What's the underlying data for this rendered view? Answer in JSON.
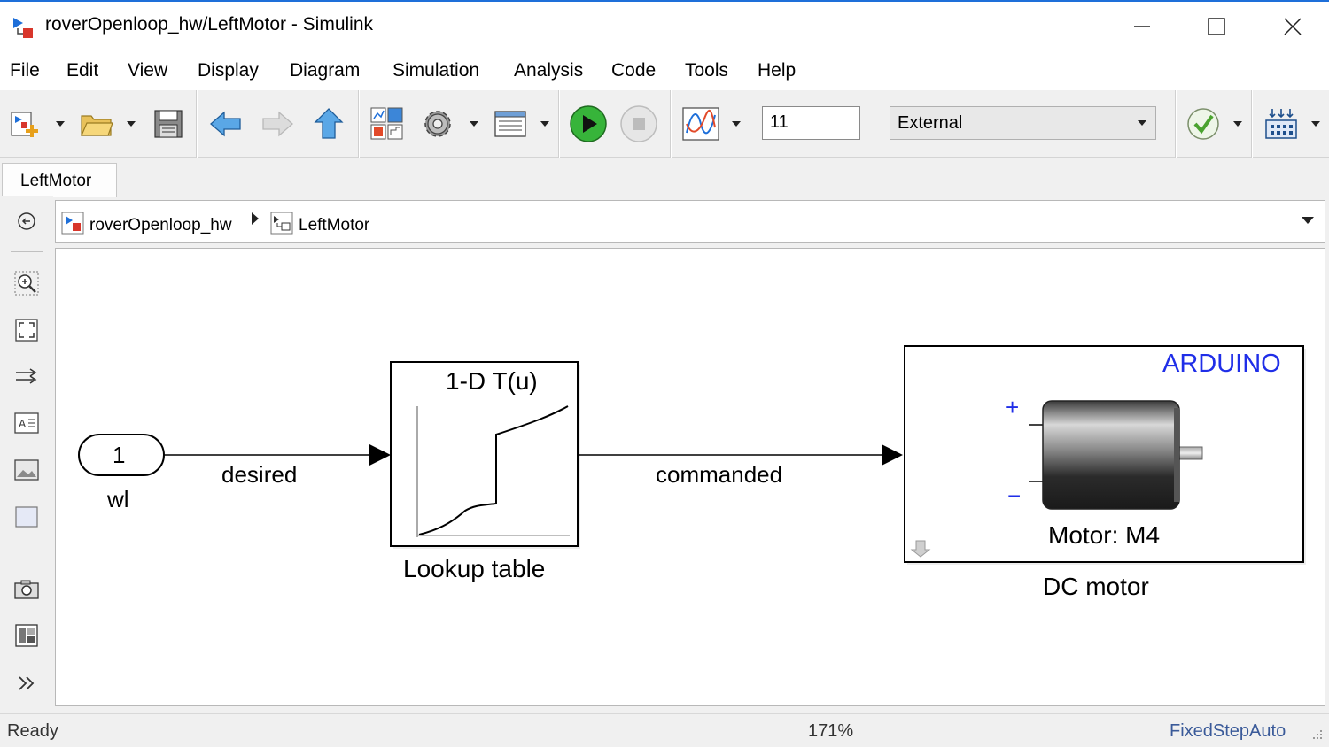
{
  "window": {
    "title": "roverOpenloop_hw/LeftMotor - Simulink"
  },
  "menu": {
    "items": [
      "File",
      "Edit",
      "View",
      "Display",
      "Diagram",
      "Simulation",
      "Analysis",
      "Code",
      "Tools",
      "Help"
    ]
  },
  "toolbar": {
    "stop_time": "11",
    "sim_mode": "External",
    "icons": [
      "new-model-icon",
      "open-folder-icon",
      "save-icon",
      "back-arrow-icon",
      "forward-arrow-icon",
      "up-arrow-icon",
      "library-browser-icon",
      "model-config-gear-icon",
      "model-explorer-icon",
      "run-icon",
      "stop-icon",
      "scope-icon",
      "model-advisor-check-icon",
      "build-deploy-icon"
    ]
  },
  "tabs": [
    {
      "label": "LeftMotor"
    }
  ],
  "breadcrumb": {
    "items": [
      "roverOpenloop_hw",
      "LeftMotor"
    ]
  },
  "diagram": {
    "inport": {
      "number": "1",
      "name": "wl"
    },
    "signals": {
      "s1": "desired",
      "s2": "commanded"
    },
    "lookup": {
      "header": "1-D T(u)",
      "name": "Lookup table"
    },
    "motor": {
      "brand": "ARDUINO",
      "label": "Motor: M4",
      "name": "DC motor",
      "plus": "+",
      "minus": "−"
    },
    "colors": {
      "brand": "#1f2ee8",
      "block_border": "#000000",
      "signal": "#000000"
    }
  },
  "status": {
    "left": "Ready",
    "zoom": "171%",
    "solver": "FixedStepAuto"
  }
}
